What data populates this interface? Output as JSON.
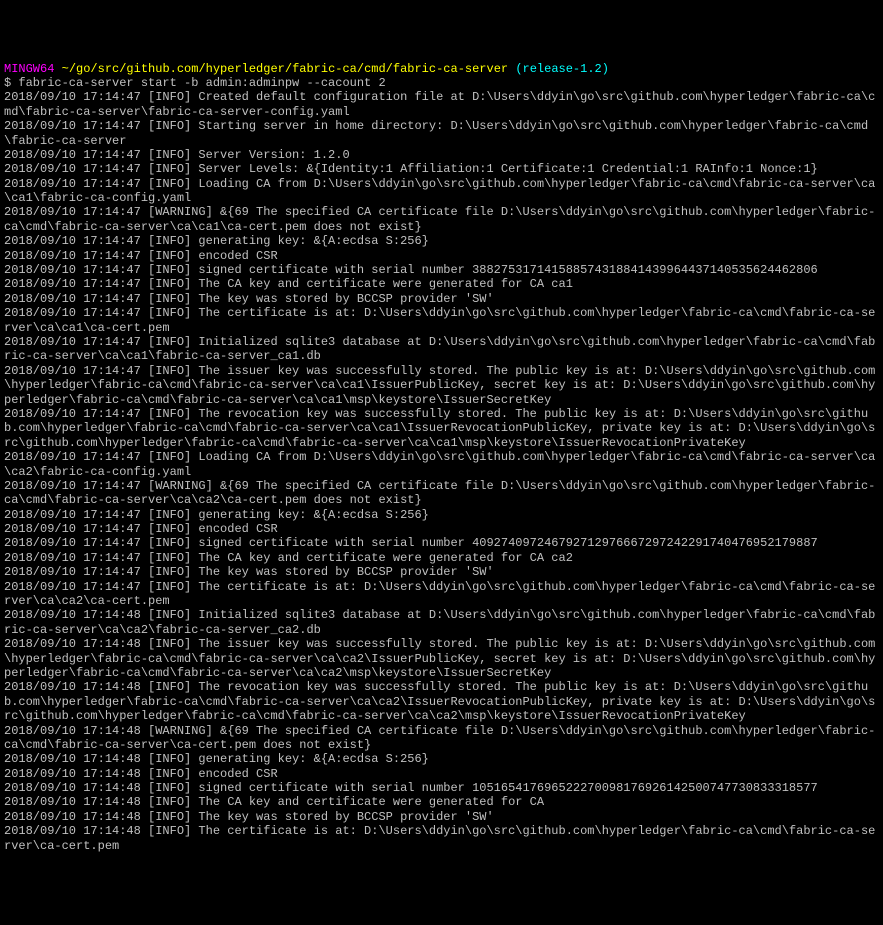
{
  "prompt": {
    "shell": "MINGW64",
    "path": "~/go/src/github.com/hyperledger/fabric-ca/cmd/fabric-ca-server",
    "branch": "(release-1.2)"
  },
  "command": "$ fabric-ca-server start -b admin:adminpw --cacount 2",
  "lines": [
    "2018/09/10 17:14:47 [INFO] Created default configuration file at D:\\Users\\ddyin\\go\\src\\github.com\\hyperledger\\fabric-ca\\cmd\\fabric-ca-server\\fabric-ca-server-config.yaml",
    "2018/09/10 17:14:47 [INFO] Starting server in home directory: D:\\Users\\ddyin\\go\\src\\github.com\\hyperledger\\fabric-ca\\cmd\\fabric-ca-server",
    "2018/09/10 17:14:47 [INFO] Server Version: 1.2.0",
    "2018/09/10 17:14:47 [INFO] Server Levels: &{Identity:1 Affiliation:1 Certificate:1 Credential:1 RAInfo:1 Nonce:1}",
    "2018/09/10 17:14:47 [INFO] Loading CA from D:\\Users\\ddyin\\go\\src\\github.com\\hyperledger\\fabric-ca\\cmd\\fabric-ca-server\\ca\\ca1\\fabric-ca-config.yaml",
    "2018/09/10 17:14:47 [WARNING] &{69 The specified CA certificate file D:\\Users\\ddyin\\go\\src\\github.com\\hyperledger\\fabric-ca\\cmd\\fabric-ca-server\\ca\\ca1\\ca-cert.pem does not exist}",
    "2018/09/10 17:14:47 [INFO] generating key: &{A:ecdsa S:256}",
    "2018/09/10 17:14:47 [INFO] encoded CSR",
    "2018/09/10 17:14:47 [INFO] signed certificate with serial number 388275317141588574318841439964437140535624462806",
    "2018/09/10 17:14:47 [INFO] The CA key and certificate were generated for CA ca1",
    "2018/09/10 17:14:47 [INFO] The key was stored by BCCSP provider 'SW'",
    "2018/09/10 17:14:47 [INFO] The certificate is at: D:\\Users\\ddyin\\go\\src\\github.com\\hyperledger\\fabric-ca\\cmd\\fabric-ca-server\\ca\\ca1\\ca-cert.pem",
    "2018/09/10 17:14:47 [INFO] Initialized sqlite3 database at D:\\Users\\ddyin\\go\\src\\github.com\\hyperledger\\fabric-ca\\cmd\\fabric-ca-server\\ca\\ca1\\fabric-ca-server_ca1.db",
    "2018/09/10 17:14:47 [INFO] The issuer key was successfully stored. The public key is at: D:\\Users\\ddyin\\go\\src\\github.com\\hyperledger\\fabric-ca\\cmd\\fabric-ca-server\\ca\\ca1\\IssuerPublicKey, secret key is at: D:\\Users\\ddyin\\go\\src\\github.com\\hyperledger\\fabric-ca\\cmd\\fabric-ca-server\\ca\\ca1\\msp\\keystore\\IssuerSecretKey",
    "2018/09/10 17:14:47 [INFO] The revocation key was successfully stored. The public key is at: D:\\Users\\ddyin\\go\\src\\github.com\\hyperledger\\fabric-ca\\cmd\\fabric-ca-server\\ca\\ca1\\IssuerRevocationPublicKey, private key is at: D:\\Users\\ddyin\\go\\src\\github.com\\hyperledger\\fabric-ca\\cmd\\fabric-ca-server\\ca\\ca1\\msp\\keystore\\IssuerRevocationPrivateKey",
    "2018/09/10 17:14:47 [INFO] Loading CA from D:\\Users\\ddyin\\go\\src\\github.com\\hyperledger\\fabric-ca\\cmd\\fabric-ca-server\\ca\\ca2\\fabric-ca-config.yaml",
    "2018/09/10 17:14:47 [WARNING] &{69 The specified CA certificate file D:\\Users\\ddyin\\go\\src\\github.com\\hyperledger\\fabric-ca\\cmd\\fabric-ca-server\\ca\\ca2\\ca-cert.pem does not exist}",
    "2018/09/10 17:14:47 [INFO] generating key: &{A:ecdsa S:256}",
    "2018/09/10 17:14:47 [INFO] encoded CSR",
    "2018/09/10 17:14:47 [INFO] signed certificate with serial number 409274097246792712976667297242291740476952179887",
    "2018/09/10 17:14:47 [INFO] The CA key and certificate were generated for CA ca2",
    "2018/09/10 17:14:47 [INFO] The key was stored by BCCSP provider 'SW'",
    "2018/09/10 17:14:47 [INFO] The certificate is at: D:\\Users\\ddyin\\go\\src\\github.com\\hyperledger\\fabric-ca\\cmd\\fabric-ca-server\\ca\\ca2\\ca-cert.pem",
    "2018/09/10 17:14:48 [INFO] Initialized sqlite3 database at D:\\Users\\ddyin\\go\\src\\github.com\\hyperledger\\fabric-ca\\cmd\\fabric-ca-server\\ca\\ca2\\fabric-ca-server_ca2.db",
    "2018/09/10 17:14:48 [INFO] The issuer key was successfully stored. The public key is at: D:\\Users\\ddyin\\go\\src\\github.com\\hyperledger\\fabric-ca\\cmd\\fabric-ca-server\\ca\\ca2\\IssuerPublicKey, secret key is at: D:\\Users\\ddyin\\go\\src\\github.com\\hyperledger\\fabric-ca\\cmd\\fabric-ca-server\\ca\\ca2\\msp\\keystore\\IssuerSecretKey",
    "2018/09/10 17:14:48 [INFO] The revocation key was successfully stored. The public key is at: D:\\Users\\ddyin\\go\\src\\github.com\\hyperledger\\fabric-ca\\cmd\\fabric-ca-server\\ca\\ca2\\IssuerRevocationPublicKey, private key is at: D:\\Users\\ddyin\\go\\src\\github.com\\hyperledger\\fabric-ca\\cmd\\fabric-ca-server\\ca\\ca2\\msp\\keystore\\IssuerRevocationPrivateKey",
    "2018/09/10 17:14:48 [WARNING] &{69 The specified CA certificate file D:\\Users\\ddyin\\go\\src\\github.com\\hyperledger\\fabric-ca\\cmd\\fabric-ca-server\\ca-cert.pem does not exist}",
    "2018/09/10 17:14:48 [INFO] generating key: &{A:ecdsa S:256}",
    "2018/09/10 17:14:48 [INFO] encoded CSR",
    "2018/09/10 17:14:48 [INFO] signed certificate with serial number 105165417696522270098176926142500747730833318577",
    "2018/09/10 17:14:48 [INFO] The CA key and certificate were generated for CA",
    "2018/09/10 17:14:48 [INFO] The key was stored by BCCSP provider 'SW'",
    "2018/09/10 17:14:48 [INFO] The certificate is at: D:\\Users\\ddyin\\go\\src\\github.com\\hyperledger\\fabric-ca\\cmd\\fabric-ca-server\\ca-cert.pem"
  ]
}
